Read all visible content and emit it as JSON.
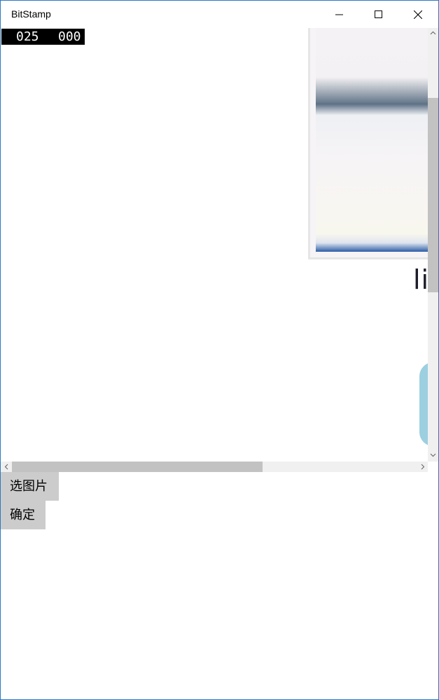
{
  "window": {
    "title": "BitStamp"
  },
  "counter": {
    "left_value": "025",
    "right_value": "000"
  },
  "image_fragment": {
    "text": "li"
  },
  "buttons": {
    "pick_image": "选图片",
    "confirm": "确定"
  },
  "icons": {
    "minimize": "minimize-icon",
    "maximize": "maximize-icon",
    "close": "close-icon"
  },
  "colors": {
    "window_border": "#2b78c4",
    "button_bg": "#cccccc",
    "scroll_thumb": "#c2c2c2",
    "scroll_track": "#f0f0f0"
  }
}
